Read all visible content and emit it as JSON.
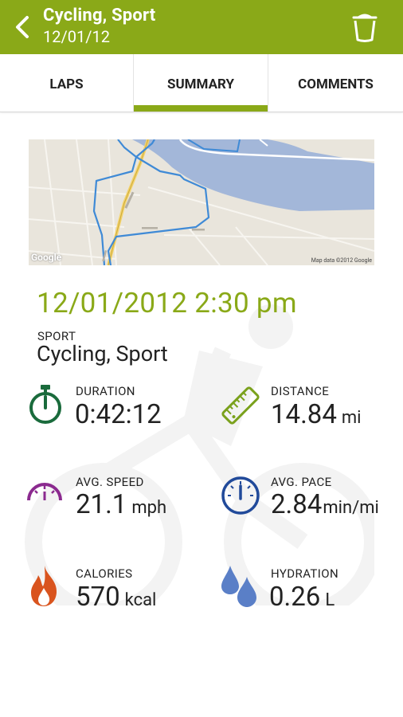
{
  "header": {
    "title": "Cycling, Sport",
    "subtitle": "12/01/12",
    "back_icon": "chevron-left-icon",
    "delete_icon": "trash-icon",
    "color": "#8aa918"
  },
  "tabs": [
    {
      "label": "LAPS"
    },
    {
      "label": "SUMMARY",
      "active": true
    },
    {
      "label": "COMMENTS"
    }
  ],
  "map": {
    "attribution": "Map data ©2012 Google",
    "logo": "Google"
  },
  "workout": {
    "datetime": "12/01/2012 2:30 pm",
    "sport_label": "SPORT",
    "sport_value": "Cycling, Sport"
  },
  "stats": {
    "duration": {
      "label": "DURATION",
      "value": "0:42:12",
      "unit": "",
      "icon": "stopwatch-icon",
      "color": "#1a6b3c"
    },
    "distance": {
      "label": "DISTANCE",
      "value": "14.84",
      "unit": "mi",
      "icon": "ruler-icon",
      "color": "#7aa11c"
    },
    "avg_speed": {
      "label": "AVG. SPEED",
      "value": "21.1",
      "unit": "mph",
      "icon": "speed-gauge-icon",
      "color": "#8b2a8f"
    },
    "avg_pace": {
      "label": "AVG. PACE",
      "value": "2.84",
      "unit": "min/mi",
      "icon": "pace-dial-icon",
      "color": "#214a9a"
    },
    "calories": {
      "label": "CALORIES",
      "value": "570",
      "unit": "kcal",
      "icon": "flame-icon",
      "color": "#d9541e"
    },
    "hydration": {
      "label": "HYDRATION",
      "value": "0.26",
      "unit": "L",
      "icon": "water-drops-icon",
      "color": "#5a7fc7"
    }
  }
}
